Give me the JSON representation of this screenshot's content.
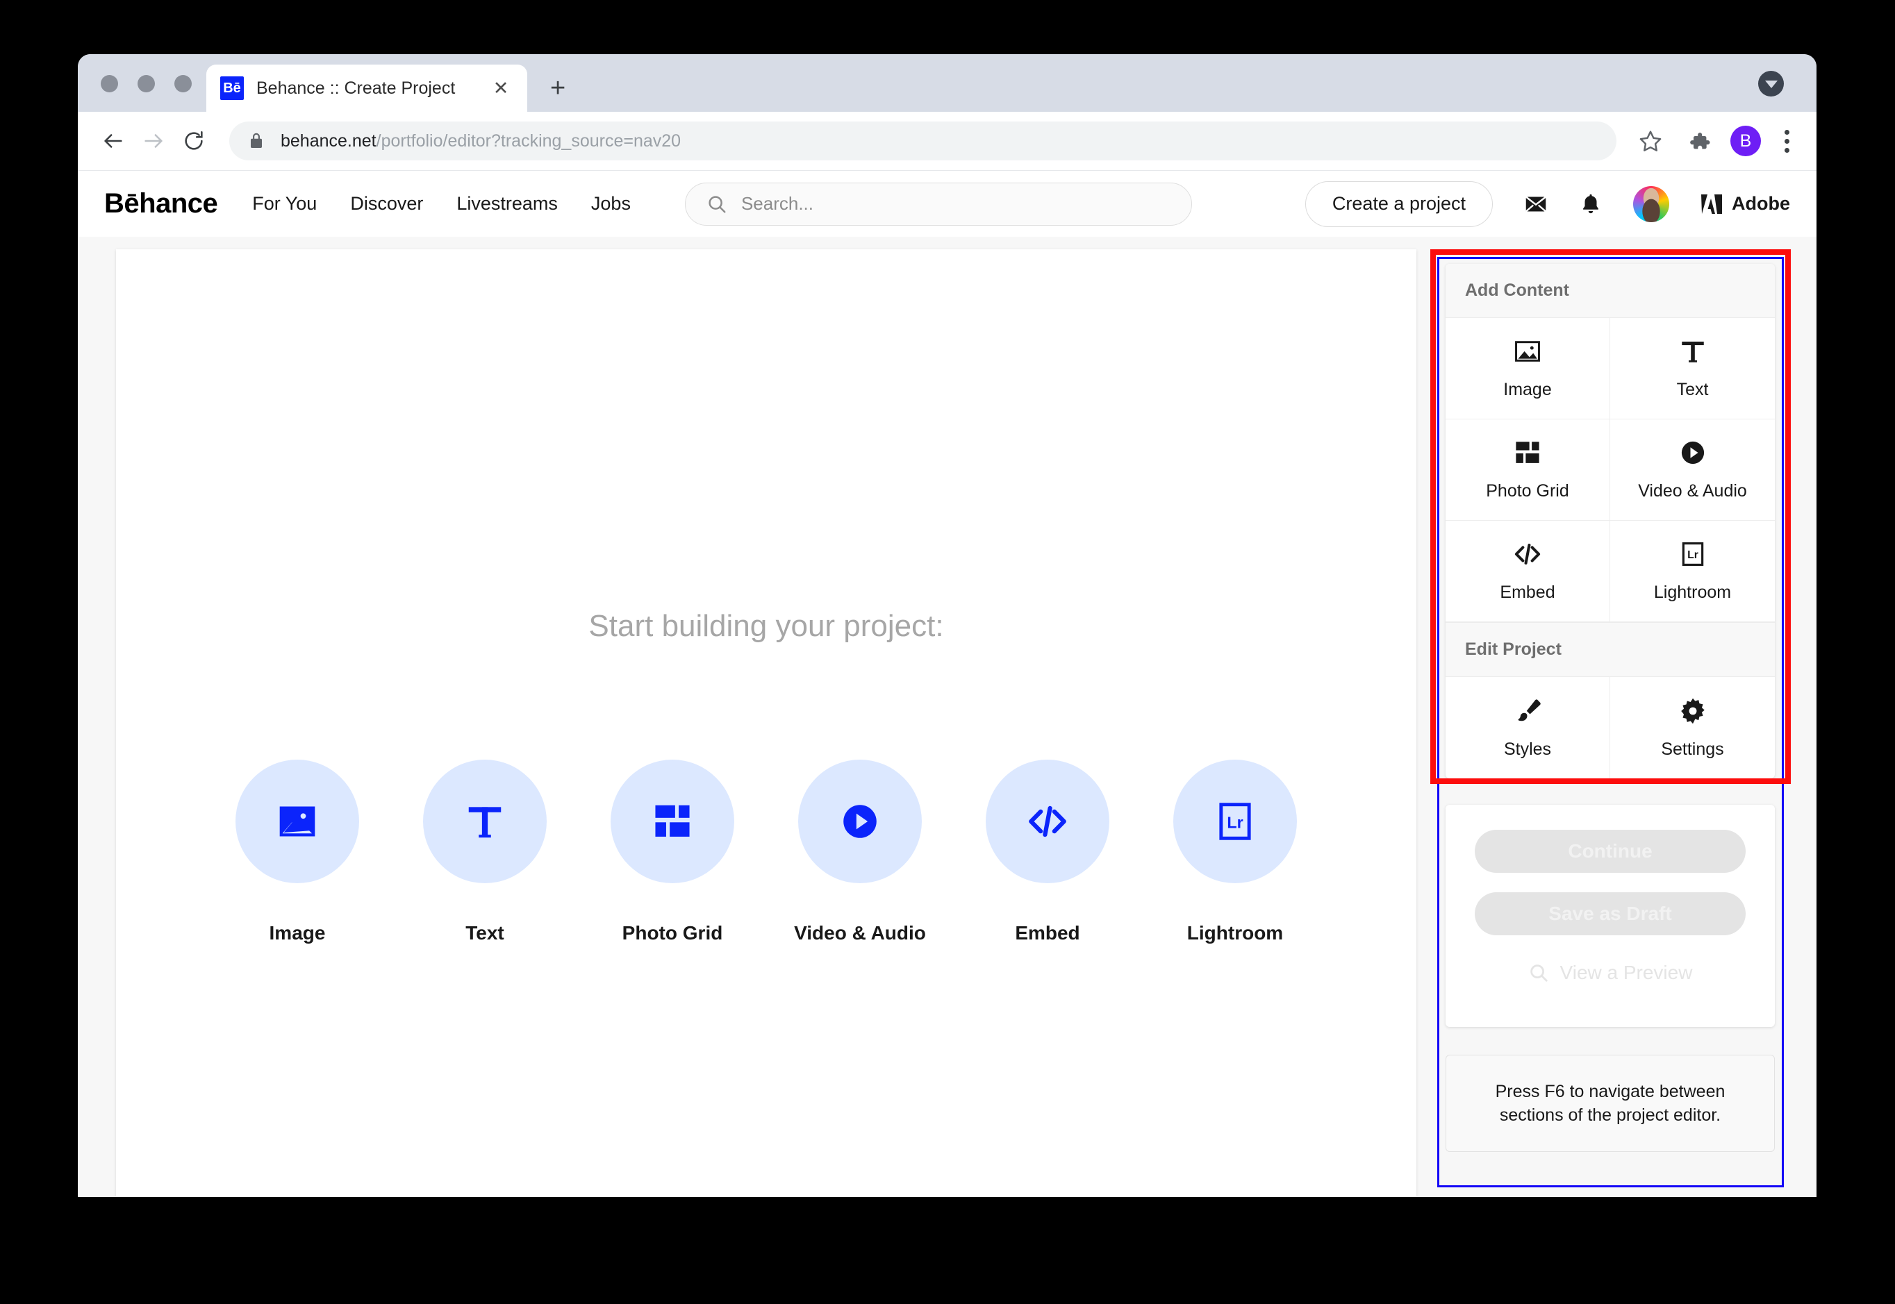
{
  "browser": {
    "tab": {
      "favicon_text": "Bē",
      "title": "Behance :: Create Project",
      "close_label": "✕"
    },
    "new_tab_label": "+",
    "omnibox": {
      "host": "behance.net",
      "path": "/portfolio/editor?tracking_source=nav20"
    },
    "profile_initial": "B"
  },
  "behance_nav": {
    "logo": "Bēhance",
    "links": [
      {
        "label": "For You"
      },
      {
        "label": "Discover"
      },
      {
        "label": "Livestreams"
      },
      {
        "label": "Jobs"
      }
    ],
    "search_placeholder": "Search...",
    "create_button": "Create a project",
    "adobe_label": "Adobe"
  },
  "canvas": {
    "title": "Start building your project:",
    "tiles": [
      {
        "label": "Image",
        "icon": "image-icon"
      },
      {
        "label": "Text",
        "icon": "text-icon"
      },
      {
        "label": "Photo Grid",
        "icon": "photo-grid-icon"
      },
      {
        "label": "Video & Audio",
        "icon": "video-audio-icon"
      },
      {
        "label": "Embed",
        "icon": "embed-icon"
      },
      {
        "label": "Lightroom",
        "icon": "lightroom-icon"
      }
    ]
  },
  "sidebar": {
    "add_content": {
      "header": "Add Content",
      "items": [
        {
          "label": "Image",
          "icon": "image-icon"
        },
        {
          "label": "Text",
          "icon": "text-icon"
        },
        {
          "label": "Photo Grid",
          "icon": "photo-grid-icon"
        },
        {
          "label": "Video & Audio",
          "icon": "video-audio-icon"
        },
        {
          "label": "Embed",
          "icon": "embed-icon"
        },
        {
          "label": "Lightroom",
          "icon": "lightroom-icon"
        }
      ]
    },
    "edit_project": {
      "header": "Edit Project",
      "items": [
        {
          "label": "Styles",
          "icon": "brush-icon"
        },
        {
          "label": "Settings",
          "icon": "gear-icon"
        }
      ]
    },
    "actions": {
      "continue_label": "Continue",
      "save_draft_label": "Save as Draft",
      "preview_label": "View a Preview"
    },
    "hint": "Press F6 to navigate between sections of the project editor."
  },
  "colors": {
    "accent_blue": "#0b24fb",
    "tile_bg": "#dce8ff",
    "highlight_red": "#fc0d0d",
    "highlight_blue": "#1307f7"
  }
}
